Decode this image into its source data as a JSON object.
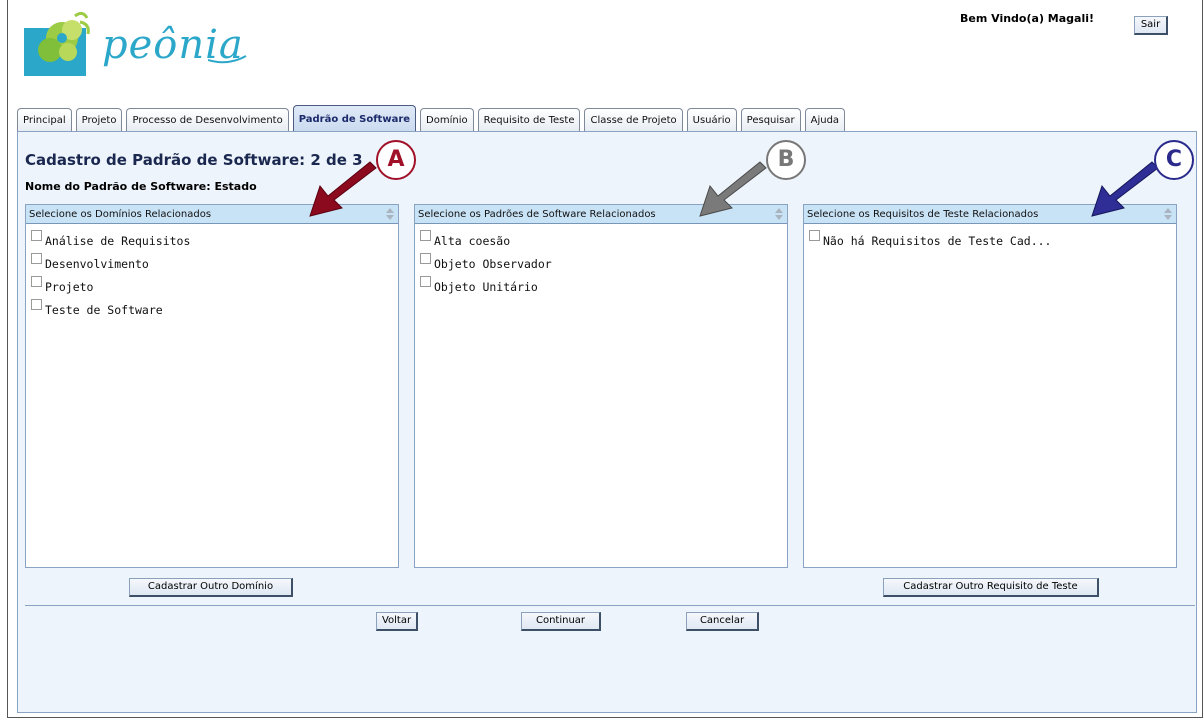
{
  "header": {
    "logo_text": "peônia",
    "welcome": "Bem Vindo(a) Magali!",
    "logout_label": "Sair"
  },
  "tabs": [
    {
      "label": "Principal"
    },
    {
      "label": "Projeto"
    },
    {
      "label": "Processo de Desenvolvimento"
    },
    {
      "label": "Padrão de Software"
    },
    {
      "label": "Domínio"
    },
    {
      "label": "Requisito de Teste"
    },
    {
      "label": "Classe de Projeto"
    },
    {
      "label": "Usuário"
    },
    {
      "label": "Pesquisar"
    },
    {
      "label": "Ajuda"
    }
  ],
  "page": {
    "title": "Cadastro de Padrão de Software: 2 de 3",
    "name_line": "Nome do Padrão de Software: Estado"
  },
  "lists": {
    "domains": {
      "header": "Selecione os Domínios Relacionados",
      "items": [
        "Análise de Requisitos",
        "Desenvolvimento",
        "Projeto",
        "Teste de Software"
      ]
    },
    "patterns": {
      "header": "Selecione os Padrões de Software Relacionados",
      "items": [
        "Alta coesão",
        "Objeto Observador",
        "Objeto Unitário"
      ]
    },
    "requirements": {
      "header": "Selecione os Requisitos de Teste Relacionados",
      "items": [
        "Não há Requisitos de Teste Cad..."
      ]
    }
  },
  "buttons": {
    "add_domain": "Cadastrar Outro Domínio",
    "add_requirement": "Cadastrar Outro Requisito de Teste",
    "back": "Voltar",
    "continue": "Continuar",
    "cancel": "Cancelar"
  },
  "annotations": {
    "a": {
      "label": "A",
      "color": "#a01028"
    },
    "b": {
      "label": "B",
      "color": "#777777"
    },
    "c": {
      "label": "C",
      "color": "#2a2a8c"
    }
  }
}
